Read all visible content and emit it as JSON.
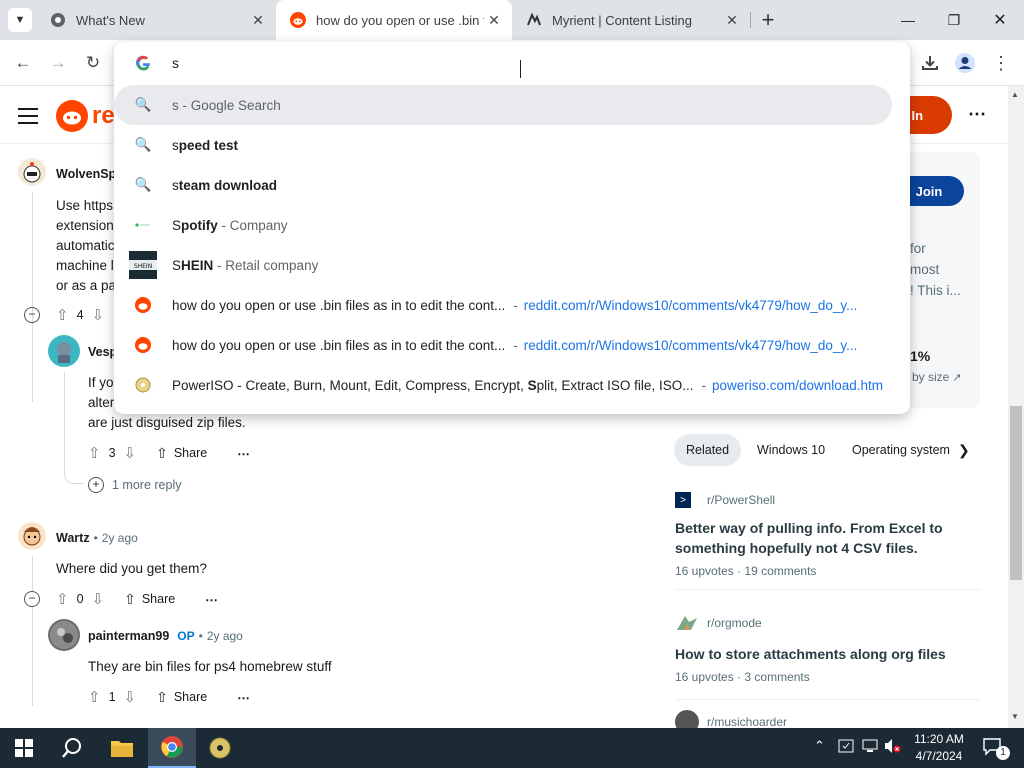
{
  "browser": {
    "tabs": [
      {
        "title": "What's New",
        "icon": "chrome-icon",
        "active": false
      },
      {
        "title": "how do you open or use .bin fil",
        "icon": "reddit-icon",
        "active": true
      },
      {
        "title": "Myrient | Content Listing",
        "icon": "myrient-icon",
        "active": false
      }
    ],
    "new_tab": "+",
    "omnibox_value": "s"
  },
  "suggestions": [
    {
      "prefix": "s",
      "rest": " - Google Search",
      "bold": false,
      "icon": "search-icon"
    },
    {
      "prefix": "s",
      "rest": "peed test",
      "bold": true,
      "icon": "search-icon"
    },
    {
      "prefix": "s",
      "rest": "team download",
      "bold": true,
      "icon": "search-icon"
    },
    {
      "prefix": "S",
      "rest": "potify",
      "desc": " - Company",
      "icon": "spotify-icon"
    },
    {
      "prefix": "S",
      "rest": "HEIN",
      "desc": " - Retail company",
      "icon": "shein-icon"
    },
    {
      "title": "how do you open or use .bin files as in to edit the cont...",
      "url": "reddit.com/r/Windows10/comments/vk4779/how_do_y...",
      "icon": "reddit-icon"
    },
    {
      "title": "how do you open or use .bin files as in to edit the cont...",
      "url": "reddit.com/r/Windows10/comments/vk4779/how_do_y...",
      "icon": "reddit-icon"
    },
    {
      "title_a": "PowerISO - Create, Burn, Mount, Edit, Compress, Encrypt, ",
      "title_b": "S",
      "title_c": "plit, Extract ISO file, ISO...",
      "url": "poweriso.com/download.htm",
      "icon": "poweriso-icon"
    }
  ],
  "reddit": {
    "login_label": "g In",
    "join_label": "Join",
    "logo_partial": "re",
    "sidebar_fragments": [
      "for",
      "most",
      "! This i...",
      "1%",
      "by size"
    ],
    "comments": [
      {
        "user": "WolvenSp",
        "lines": [
          "Use https",
          "extension",
          "automatic",
          "machine l",
          "or as a pa"
        ],
        "votes": "4"
      },
      {
        "user": "Vesp",
        "lines": [
          "If yo",
          "alter",
          "are just disguised zip files."
        ],
        "votes": "3",
        "share": "Share",
        "more": "1 more reply"
      },
      {
        "user": "Wartz",
        "time": "2y ago",
        "text": "Where did you get them?",
        "votes": "0",
        "share": "Share"
      },
      {
        "user": "painterman99",
        "op": "OP",
        "time": "2y ago",
        "text": "They are bin files for ps4 homebrew stuff",
        "votes": "1",
        "share": "Share"
      }
    ],
    "chips": [
      "Related",
      "Windows 10",
      "Operating system"
    ],
    "related": [
      {
        "sub": "r/PowerShell",
        "title": "Better way of pulling info. From Excel to something hopefully not 4 CSV files.",
        "upvotes": "16 upvotes",
        "comments": "19 comments"
      },
      {
        "sub": "r/orgmode",
        "title": "How to store attachments along org files",
        "upvotes": "16 upvotes",
        "comments": "3 comments"
      },
      {
        "sub": "r/musichoarder"
      }
    ]
  },
  "taskbar": {
    "time": "11:20 AM",
    "date": "4/7/2024",
    "notif_count": "1"
  }
}
